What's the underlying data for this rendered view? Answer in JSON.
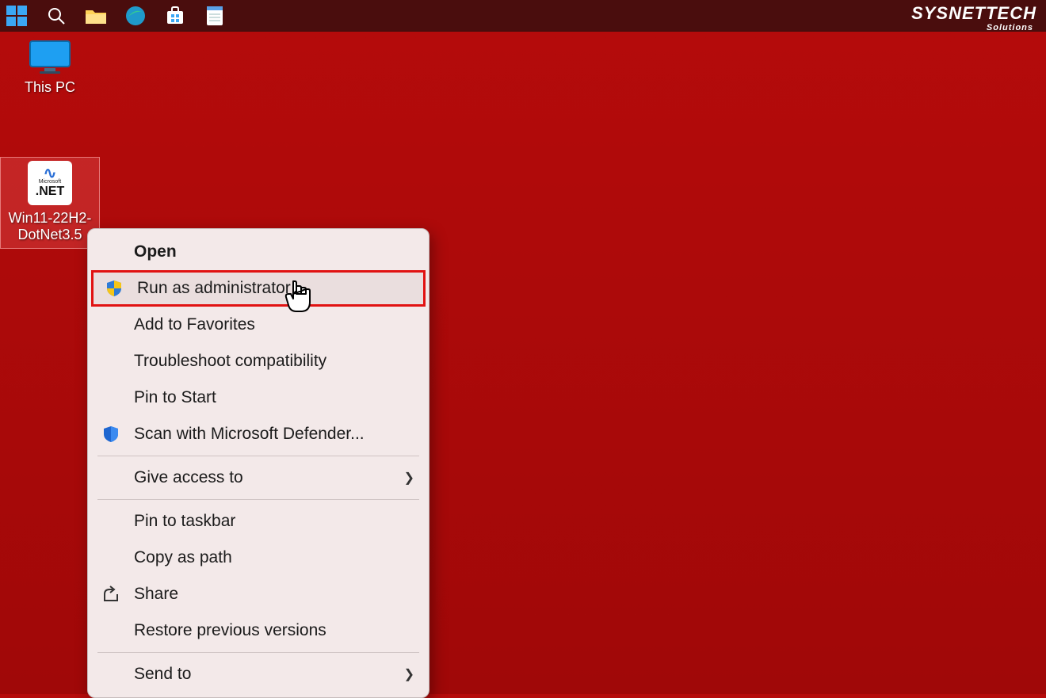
{
  "taskbar": {
    "items": [
      "start",
      "search",
      "explorer",
      "edge",
      "store",
      "notepad"
    ]
  },
  "watermark": {
    "title": "SYSNETTECH",
    "subtitle": "Solutions"
  },
  "desktop": {
    "thispc_label": "This PC",
    "netfile_label": "Win11-22H2-DotNet3.5",
    "neticon_ms": "Microsoft",
    "neticon_net": ".NET"
  },
  "context_menu": {
    "items": [
      {
        "label": "Open",
        "bold": true
      },
      {
        "label": "Run as administrator",
        "icon": "uac-shield",
        "highlight": true
      },
      {
        "label": "Add to Favorites"
      },
      {
        "label": "Troubleshoot compatibility"
      },
      {
        "label": "Pin to Start"
      },
      {
        "label": "Scan with Microsoft Defender...",
        "icon": "defender-shield"
      },
      {
        "sep": true
      },
      {
        "label": "Give access to",
        "submenu": true
      },
      {
        "sep": true
      },
      {
        "label": "Pin to taskbar"
      },
      {
        "label": "Copy as path"
      },
      {
        "label": "Share",
        "icon": "share"
      },
      {
        "label": "Restore previous versions"
      },
      {
        "sep": true
      },
      {
        "label": "Send to",
        "submenu": true
      }
    ]
  }
}
